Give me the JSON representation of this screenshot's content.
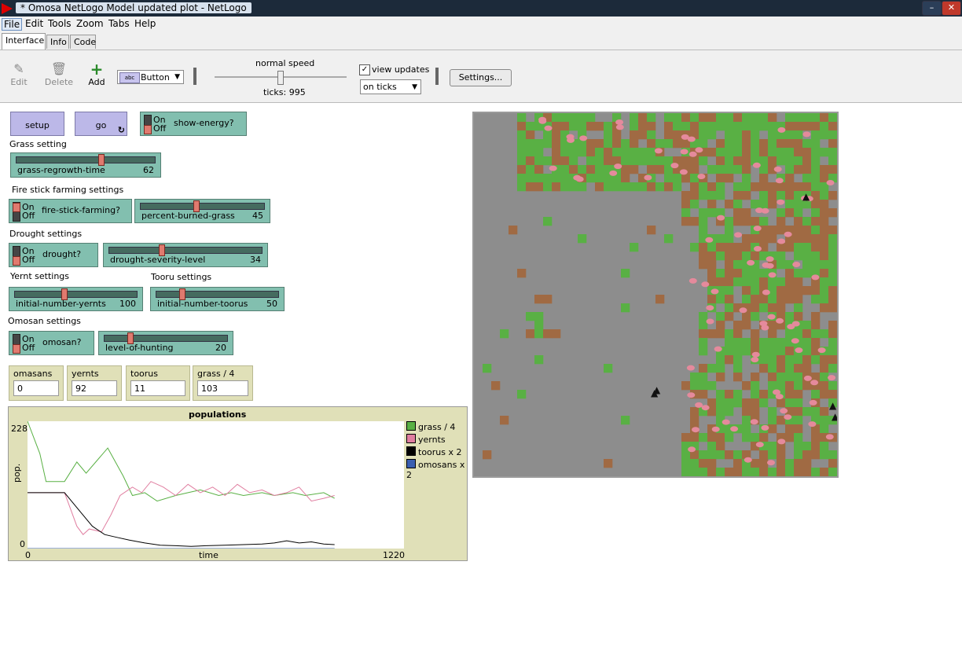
{
  "window": {
    "title": "* Omosa NetLogo Model updated plot - NetLogo"
  },
  "menu": [
    "File",
    "Edit",
    "Tools",
    "Zoom",
    "Tabs",
    "Help"
  ],
  "tabs": [
    "Interface",
    "Info",
    "Code"
  ],
  "toolbar": {
    "edit": "Edit",
    "delete": "Delete",
    "add": "Add",
    "widget_type": "Button",
    "speed_label": "normal speed",
    "ticks": "ticks: 995",
    "view_updates": "view updates",
    "update_mode": "on ticks",
    "settings": "Settings..."
  },
  "buttons": {
    "setup": "setup",
    "go": "go"
  },
  "switches": {
    "show_energy": {
      "label": "show-energy?",
      "on": "On",
      "off": "Off"
    },
    "fire_stick": {
      "label": "fire-stick-farming?",
      "on": "On",
      "off": "Off"
    },
    "drought": {
      "label": "drought?",
      "on": "On",
      "off": "Off"
    },
    "omosan": {
      "label": "omosan?",
      "on": "On",
      "off": "Off"
    }
  },
  "notes": {
    "grass": "Grass setting",
    "fire": "Fire stick farming settings",
    "drought": "Drought settings",
    "yernt": "Yernt settings",
    "tooru": "Tooru settings",
    "omosan": "Omosan settings"
  },
  "sliders": {
    "grass_regrowth": {
      "label": "grass-regrowth-time",
      "value": "62",
      "fraction": 0.62
    },
    "percent_burned": {
      "label": "percent-burned-grass",
      "value": "45",
      "fraction": 0.45
    },
    "drought_severity": {
      "label": "drought-severity-level",
      "value": "34",
      "fraction": 0.34
    },
    "initial_yernts": {
      "label": "initial-number-yernts",
      "value": "100",
      "fraction": 0.4
    },
    "initial_toorus": {
      "label": "initial-number-toorus",
      "value": "50",
      "fraction": 0.2
    },
    "level_hunting": {
      "label": "level-of-hunting",
      "value": "20",
      "fraction": 0.2
    }
  },
  "monitors": [
    {
      "label": "omasans",
      "value": "0"
    },
    {
      "label": "yernts",
      "value": "92"
    },
    {
      "label": "toorus",
      "value": "11"
    },
    {
      "label": "grass / 4",
      "value": "103"
    }
  ],
  "plot": {
    "title": "populations",
    "ylabel": "pop.",
    "xlabel": "time",
    "ymax_label": "228",
    "ymin_label": "0",
    "xmin_label": "0",
    "xmax_label": "1220",
    "legend": [
      {
        "name": "grass / 4",
        "color": "#59b044"
      },
      {
        "name": "yernts",
        "color": "#e07ea0"
      },
      {
        "name": "toorus x 2",
        "color": "#000000"
      },
      {
        "name": "omosans x 2",
        "color": "#3a5fb0"
      }
    ]
  },
  "chart_data": {
    "type": "line",
    "title": "populations",
    "xlabel": "time",
    "ylabel": "pop.",
    "xlim": [
      0,
      1220
    ],
    "ylim": [
      0,
      228
    ],
    "series": [
      {
        "name": "grass / 4",
        "color": "#59b044",
        "x": [
          0,
          40,
          60,
          120,
          160,
          190,
          260,
          310,
          340,
          380,
          420,
          480,
          520,
          560,
          620,
          660,
          700,
          760,
          800,
          860,
          900,
          960,
          995
        ],
        "y": [
          228,
          170,
          120,
          120,
          155,
          135,
          180,
          130,
          95,
          100,
          85,
          95,
          100,
          105,
          95,
          100,
          95,
          100,
          95,
          100,
          95,
          100,
          90
        ]
      },
      {
        "name": "yernts",
        "color": "#e07ea0",
        "x": [
          0,
          120,
          140,
          160,
          180,
          200,
          240,
          270,
          300,
          340,
          370,
          400,
          440,
          480,
          520,
          560,
          600,
          640,
          680,
          720,
          760,
          800,
          840,
          880,
          920,
          960,
          995
        ],
        "y": [
          100,
          100,
          70,
          40,
          25,
          35,
          30,
          60,
          95,
          110,
          100,
          120,
          110,
          95,
          115,
          100,
          110,
          95,
          115,
          100,
          105,
          95,
          100,
          110,
          85,
          90,
          95
        ]
      },
      {
        "name": "toorus x 2",
        "color": "#000000",
        "x": [
          0,
          120,
          150,
          180,
          210,
          250,
          290,
          330,
          380,
          430,
          480,
          530,
          580,
          640,
          700,
          760,
          800,
          840,
          880,
          920,
          960,
          995
        ],
        "y": [
          100,
          100,
          80,
          60,
          40,
          25,
          20,
          15,
          10,
          6,
          5,
          4,
          5,
          6,
          7,
          8,
          10,
          14,
          10,
          12,
          8,
          7
        ]
      },
      {
        "name": "omosans x 2",
        "color": "#3a5fb0",
        "x": [
          0,
          995
        ],
        "y": [
          0,
          0
        ]
      }
    ]
  },
  "world": {
    "patch_colors": {
      "empty": "#8d8d8d",
      "grass": "#59b044",
      "dirt": "#a06a43"
    },
    "yernt_color": "#e58a9c",
    "tooru_color": "#111111"
  }
}
